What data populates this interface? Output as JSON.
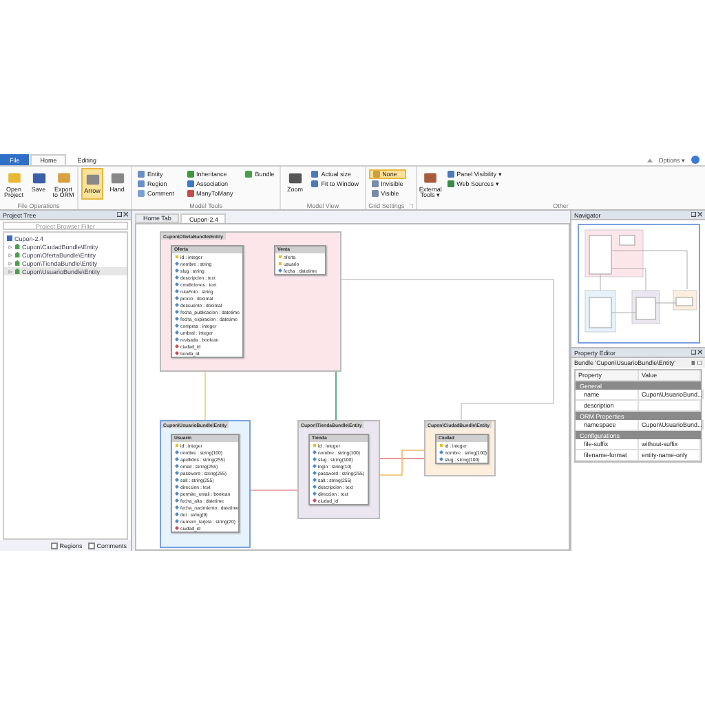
{
  "ribbon_tabs": [
    {
      "label": "File",
      "kind": "file",
      "selected": false
    },
    {
      "label": "Home",
      "kind": "tab",
      "selected": true
    },
    {
      "label": "Editing",
      "kind": "tab",
      "selected": false
    }
  ],
  "options_menu": "Options ▾",
  "ribbon_groups": [
    {
      "label": "File Operations",
      "buttons": [
        {
          "label": "Open Project",
          "kind": "large"
        },
        {
          "label": "Save",
          "kind": "large"
        },
        {
          "label": "Export to ORM",
          "kind": "large"
        }
      ]
    },
    {
      "buttons": [
        {
          "label": "Arrow",
          "kind": "large",
          "selected": true
        },
        {
          "label": "Hand",
          "kind": "large",
          "selected": false
        }
      ]
    },
    {
      "label": "Model Tools",
      "buttons": [
        {
          "label": "Entity",
          "kind": "small"
        },
        {
          "label": "Region",
          "kind": "small"
        },
        {
          "label": "Comment",
          "kind": "small"
        },
        {
          "label": "Inheritance",
          "kind": "small"
        },
        {
          "label": "Association",
          "kind": "small"
        },
        {
          "label": "ManyToMany",
          "kind": "small"
        },
        {
          "label": "Bundle",
          "kind": "small"
        }
      ]
    },
    {
      "label": "Model View",
      "buttons": [
        {
          "label": "Zoom",
          "kind": "large"
        },
        {
          "label": "Actual size",
          "kind": "small"
        },
        {
          "label": "Fit to Window",
          "kind": "small"
        }
      ]
    },
    {
      "label": "Grid Settings",
      "launcher": true,
      "buttons": [
        {
          "label": "None",
          "kind": "small",
          "selected": true
        },
        {
          "label": "Invisible",
          "kind": "small",
          "selected": false
        },
        {
          "label": "Visible",
          "kind": "small",
          "selected": false
        }
      ]
    },
    {
      "label": "Other",
      "buttons": [
        {
          "label": "External Tools ▾",
          "kind": "large"
        },
        {
          "label": "Panel Visibility ▾",
          "kind": "small"
        },
        {
          "label": "Web Sources ▾",
          "kind": "small"
        }
      ]
    }
  ],
  "project_tree": {
    "title": "Project Tree",
    "filter": {
      "placeholder": "Project Browser Filter"
    },
    "items": [
      {
        "label": "Cupon-2.4",
        "selected": false,
        "children": [
          {
            "label": "Cupon\\CiudadBundle\\Entity",
            "selected": false
          },
          {
            "label": "Cupon\\OfertaBundle\\Entity",
            "selected": false
          },
          {
            "label": "Cupon\\TiendaBundle\\Entity",
            "selected": false
          },
          {
            "label": "Cupon\\UsuarioBundle\\Entity",
            "selected": true
          }
        ]
      }
    ],
    "options": [
      {
        "label": "Regions",
        "checked": false
      },
      {
        "label": "Comments",
        "checked": false
      }
    ]
  },
  "document_tabs": [
    {
      "label": "Home Tab",
      "selected": false
    },
    {
      "label": "Cupon-2.4",
      "selected": true
    }
  ],
  "bundles": [
    {
      "name": "Cupon\\OfertaBundle\\Entity",
      "color": "#fde6ea",
      "selected": false,
      "entities": [
        {
          "name": "Oferta",
          "fields": [
            {
              "text": "id : integer",
              "kind": "pk"
            },
            {
              "text": "nombre : string",
              "kind": "field"
            },
            {
              "text": "slug : string",
              "kind": "field"
            },
            {
              "text": "descripcion : text",
              "kind": "field"
            },
            {
              "text": "condiciones : text",
              "kind": "field"
            },
            {
              "text": "rutaFoto : string",
              "kind": "field"
            },
            {
              "text": "precio : decimal",
              "kind": "field"
            },
            {
              "text": "descuento : decimal",
              "kind": "field"
            },
            {
              "text": "fecha_publicacion : datetime",
              "kind": "field"
            },
            {
              "text": "fecha_expiracion : datetime",
              "kind": "field"
            },
            {
              "text": "compras : integer",
              "kind": "field"
            },
            {
              "text": "umbral : integer",
              "kind": "field"
            },
            {
              "text": "revisada : boolean",
              "kind": "field"
            },
            {
              "text": "ciudad_id",
              "kind": "fk"
            },
            {
              "text": "tienda_id",
              "kind": "fk"
            }
          ]
        },
        {
          "name": "Venta",
          "fields": [
            {
              "text": "oferta",
              "kind": "pk"
            },
            {
              "text": "usuario",
              "kind": "pk"
            },
            {
              "text": "fecha : datetime",
              "kind": "field"
            }
          ]
        }
      ]
    },
    {
      "name": "Cupon\\UsuarioBundle\\Entity",
      "color": "#e6f2fc",
      "selected": true,
      "entities": [
        {
          "name": "Usuario",
          "fields": [
            {
              "text": "id : integer",
              "kind": "pk"
            },
            {
              "text": "nombre : string(100)",
              "kind": "field"
            },
            {
              "text": "apellidos : string(255)",
              "kind": "field"
            },
            {
              "text": "email : string(255)",
              "kind": "field"
            },
            {
              "text": "password : string(255)",
              "kind": "field"
            },
            {
              "text": "salt : string(255)",
              "kind": "field"
            },
            {
              "text": "direccion : text",
              "kind": "field"
            },
            {
              "text": "permite_email : boolean",
              "kind": "field"
            },
            {
              "text": "fecha_alta : datetime",
              "kind": "field"
            },
            {
              "text": "fecha_nacimiento : datetime",
              "kind": "field"
            },
            {
              "text": "dni : string(9)",
              "kind": "field"
            },
            {
              "text": "numero_tarjeta : string(20)",
              "kind": "field"
            },
            {
              "text": "ciudad_id",
              "kind": "fk"
            }
          ]
        }
      ]
    },
    {
      "name": "Cupon\\TiendaBundle\\Entity",
      "color": "#ebe6f0",
      "selected": false,
      "entities": [
        {
          "name": "Tienda",
          "fields": [
            {
              "text": "id : integer",
              "kind": "pk"
            },
            {
              "text": "nombre : string(100)",
              "kind": "field"
            },
            {
              "text": "slug : string(100)",
              "kind": "field"
            },
            {
              "text": "login : string(10)",
              "kind": "field"
            },
            {
              "text": "password : string(255)",
              "kind": "field"
            },
            {
              "text": "salt : string(255)",
              "kind": "field"
            },
            {
              "text": "descripcion : text",
              "kind": "field"
            },
            {
              "text": "direccion : text",
              "kind": "field"
            },
            {
              "text": "ciudad_id",
              "kind": "fk"
            }
          ]
        }
      ]
    },
    {
      "name": "Cupon\\CiudadBundle\\Entity",
      "color": "#fdeedd",
      "selected": false,
      "entities": [
        {
          "name": "Ciudad",
          "fields": [
            {
              "text": "id : integer",
              "kind": "pk"
            },
            {
              "text": "nombre : string(100)",
              "kind": "field"
            },
            {
              "text": "slug : string(100)",
              "kind": "field"
            }
          ]
        }
      ]
    }
  ],
  "navigator": {
    "title": "Navigator"
  },
  "property_editor": {
    "title": "Property Editor",
    "subject": "Bundle 'Cupon\\UsuarioBundle\\Entity'",
    "columns": [
      "Property",
      "Value"
    ],
    "sections": [
      {
        "title": "General",
        "rows": [
          {
            "property": "name",
            "value": "Cupon\\UsuarioBund..."
          },
          {
            "property": "description"
          }
        ]
      },
      {
        "title": "ORM Properties",
        "rows": [
          {
            "property": "namespace",
            "value": "Cupon\\UsuarioBund..."
          }
        ]
      },
      {
        "title": "Configurations",
        "rows": [
          {
            "property": "file-suffix",
            "value": "without-suffix"
          },
          {
            "property": "filename-format",
            "value": "entity-name-only"
          }
        ]
      }
    ]
  }
}
